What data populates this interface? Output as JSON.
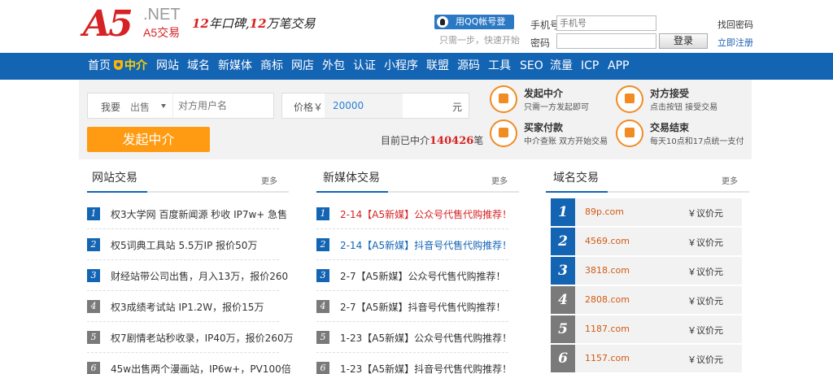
{
  "header": {
    "logo_main": "A5",
    "logo_net": ".NET",
    "logo_sub": "A5交易",
    "slogan_num1": "12",
    "slogan_text1": "年口碑,",
    "slogan_num2": "12",
    "slogan_text2": "万笔交易",
    "qq_login": "用QQ帐号登录",
    "quick_tip": "只需一步，快速开始",
    "phone_label": "手机号",
    "phone_placeholder": "手机号",
    "password_label": "密码",
    "login_button": "登录",
    "forgot_password": "找回密码",
    "register": "立即注册"
  },
  "nav": {
    "items": [
      "首页",
      "中介",
      "网站",
      "域名",
      "新媒体",
      "商标",
      "网店",
      "外包",
      "认证",
      "小程序",
      "联盟",
      "源码",
      "工具",
      "SEO",
      "流量",
      "ICP",
      "APP"
    ],
    "active": "中介"
  },
  "escrow": {
    "want_label": "我要",
    "sell_option": "出售",
    "user_placeholder": "对方用户名",
    "price_label": "价格￥",
    "price_value": "20000",
    "price_unit": "元",
    "start_button": "发起中介",
    "count_prefix": "目前已中介",
    "count_value": "140426",
    "count_suffix": "笔",
    "steps": [
      {
        "title": "发起中介",
        "desc": "只需一方发起即可"
      },
      {
        "title": "对方接受",
        "desc": "点击按钮 接受交易"
      },
      {
        "title": "买家付款",
        "desc": "中介查账 双方开始交易"
      },
      {
        "title": "交易结束",
        "desc": "每天10点和17点统一支付"
      }
    ]
  },
  "website_trade": {
    "title": "网站交易",
    "more": "更多",
    "items": [
      {
        "rank": "1",
        "text": "权3大学网 百度新闻源 秒收 IP7w+ 急售"
      },
      {
        "rank": "2",
        "text": "权5词典工具站 5.5万IP 报价50万"
      },
      {
        "rank": "3",
        "text": "财经站带公司出售，月入13万，报价260"
      },
      {
        "rank": "4",
        "text": "权3成绩考试站 IP1.2W，报价15万"
      },
      {
        "rank": "5",
        "text": "权7剧情老站秒收录，IP40万，报价260万"
      },
      {
        "rank": "6",
        "text": "45w出售两个漫画站，IP6w+，PV100倍"
      }
    ]
  },
  "media_trade": {
    "title": "新媒体交易",
    "more": "更多",
    "items": [
      {
        "rank": "1",
        "text": "2-14【A5新媒】公众号代售代购推荐！"
      },
      {
        "rank": "2",
        "text": "2-14【A5新媒】抖音号代售代购推荐！"
      },
      {
        "rank": "3",
        "text": "2-7【A5新媒】公众号代售代购推荐！"
      },
      {
        "rank": "4",
        "text": "2-7【A5新媒】抖音号代售代购推荐！"
      },
      {
        "rank": "5",
        "text": "1-23【A5新媒】公众号代售代购推荐！"
      },
      {
        "rank": "6",
        "text": "1-23【A5新媒】抖音号代售代购推荐！"
      }
    ]
  },
  "domain_trade": {
    "title": "域名交易",
    "more": "更多",
    "items": [
      {
        "rank": "1",
        "name": "89p.com",
        "price": "￥议价元"
      },
      {
        "rank": "2",
        "name": "4569.com",
        "price": "￥议价元"
      },
      {
        "rank": "3",
        "name": "3818.com",
        "price": "￥议价元"
      },
      {
        "rank": "4",
        "name": "2808.com",
        "price": "￥议价元"
      },
      {
        "rank": "5",
        "name": "1187.com",
        "price": "￥议价元"
      },
      {
        "rank": "6",
        "name": "1157.com",
        "price": "￥议价元"
      }
    ]
  },
  "colors": {
    "brand_red": "#d62224",
    "nav_blue": "#1464b4",
    "accent_orange": "#ff9b12",
    "nav_active": "#ffd200"
  }
}
